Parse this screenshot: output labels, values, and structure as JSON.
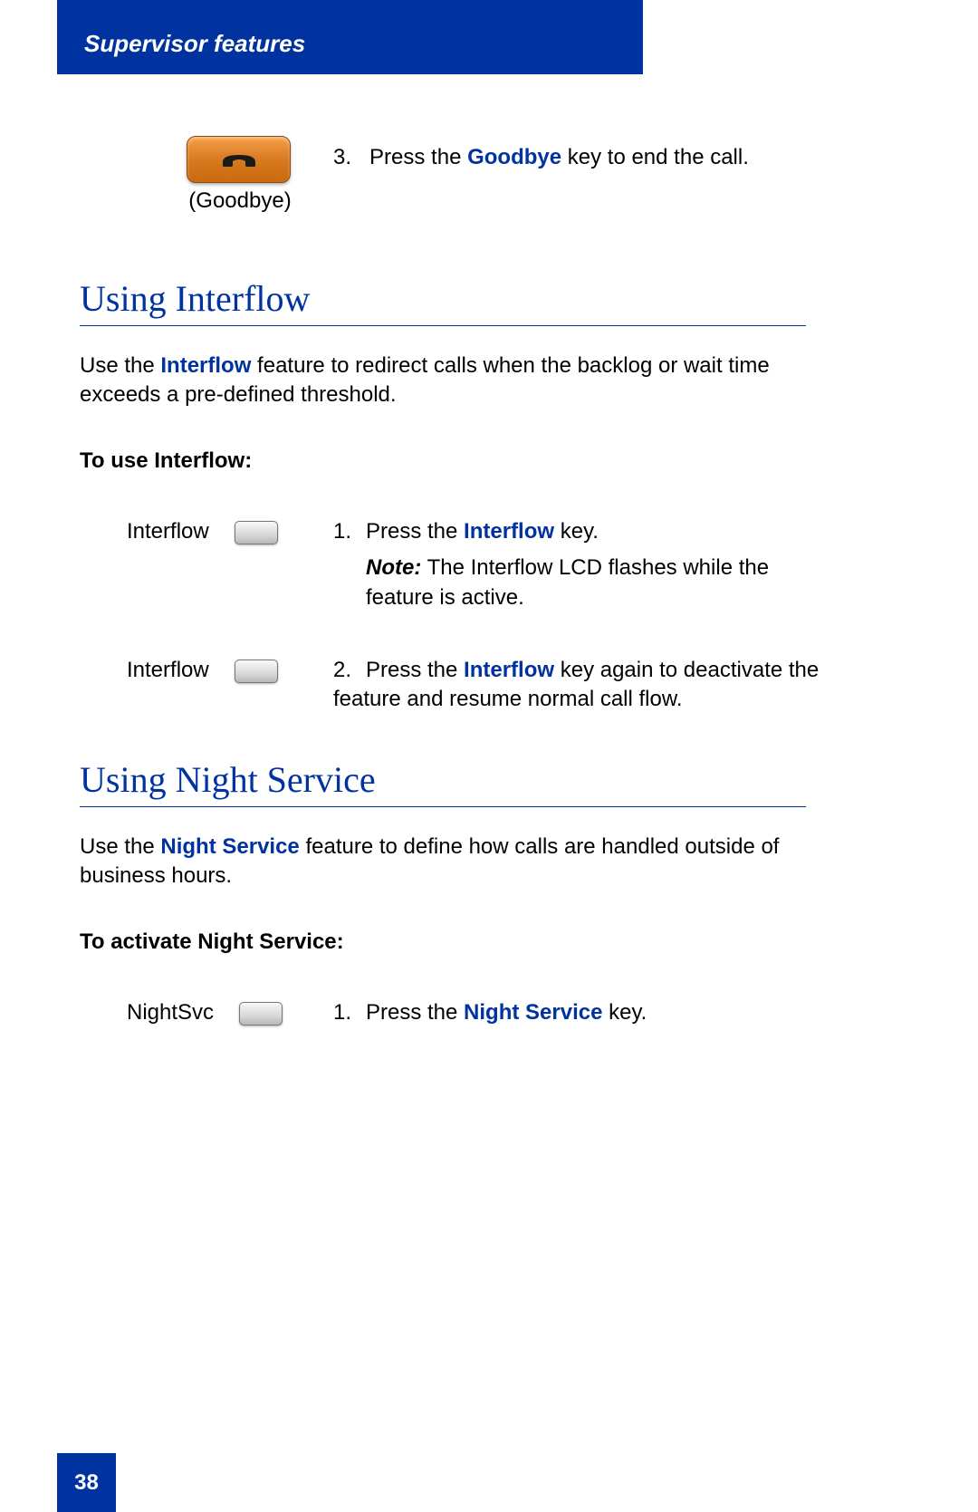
{
  "header": {
    "title": "Supervisor features"
  },
  "goodbye": {
    "label": "(Goodbye)",
    "step_num": "3.",
    "text_before": "Press the ",
    "key": "Goodbye",
    "text_after": " key to end the call."
  },
  "interflow_section": {
    "heading": "Using Interflow",
    "intro_before": "Use the ",
    "intro_key": "Interflow",
    "intro_after": " feature to redirect calls when the backlog or wait time exceeds a pre-defined threshold.",
    "sub": "To use Interflow:",
    "step1": {
      "key_label": "Interflow",
      "num": "1.",
      "text_before": "Press the ",
      "key": "Interflow",
      "text_after": " key.",
      "note_label": "Note:",
      "note_text": " The Interflow LCD flashes while the feature is active."
    },
    "step2": {
      "key_label": "Interflow",
      "num": "2.",
      "text_before": "Press the ",
      "key": "Interflow",
      "text_after": " key again to deactivate the feature and resume normal call flow."
    }
  },
  "night_section": {
    "heading": "Using Night Service",
    "intro_before": "Use the ",
    "intro_key": "Night Service",
    "intro_after": " feature to define how calls are handled outside of business hours.",
    "sub": "To activate Night Service:",
    "step1": {
      "key_label": "NightSvc",
      "num": "1.",
      "text_before": "Press the ",
      "key": "Night Service",
      "text_after": " key."
    }
  },
  "page_number": "38"
}
